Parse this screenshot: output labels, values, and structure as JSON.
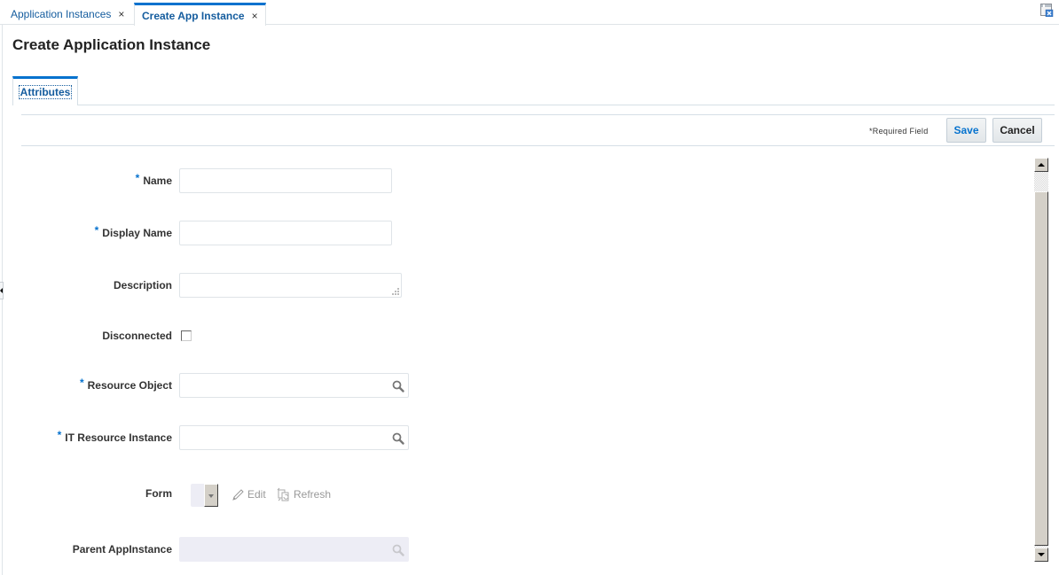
{
  "doc_tabs": [
    {
      "label": "Application Instances",
      "close": "×",
      "active": false
    },
    {
      "label": "Create App Instance",
      "close": "×",
      "active": true
    }
  ],
  "window_icon": "detach-window-icon",
  "page_title": "Create Application Instance",
  "sub_tabs": [
    {
      "label": "Attributes",
      "active": true
    }
  ],
  "toolbar": {
    "required_note": "*Required Field",
    "save_label": "Save",
    "cancel_label": "Cancel"
  },
  "form": {
    "required_marker": "*",
    "fields": {
      "name": {
        "label": "Name",
        "required": true,
        "value": ""
      },
      "display_name": {
        "label": "Display Name",
        "required": true,
        "value": ""
      },
      "description": {
        "label": "Description",
        "required": false,
        "value": ""
      },
      "disconnected": {
        "label": "Disconnected",
        "checked": false
      },
      "resource_object": {
        "label": "Resource Object",
        "required": true,
        "value": ""
      },
      "it_resource_instance": {
        "label": "IT Resource Instance",
        "required": true,
        "value": ""
      },
      "form": {
        "label": "Form",
        "selected": "",
        "edit_label": "Edit",
        "refresh_label": "Refresh"
      },
      "parent_appinstance": {
        "label": "Parent AppInstance",
        "value": "",
        "disabled": true
      }
    }
  },
  "colors": {
    "accent": "#0572ce",
    "link": "#145c9e",
    "disabled_field": "#ededf5"
  }
}
